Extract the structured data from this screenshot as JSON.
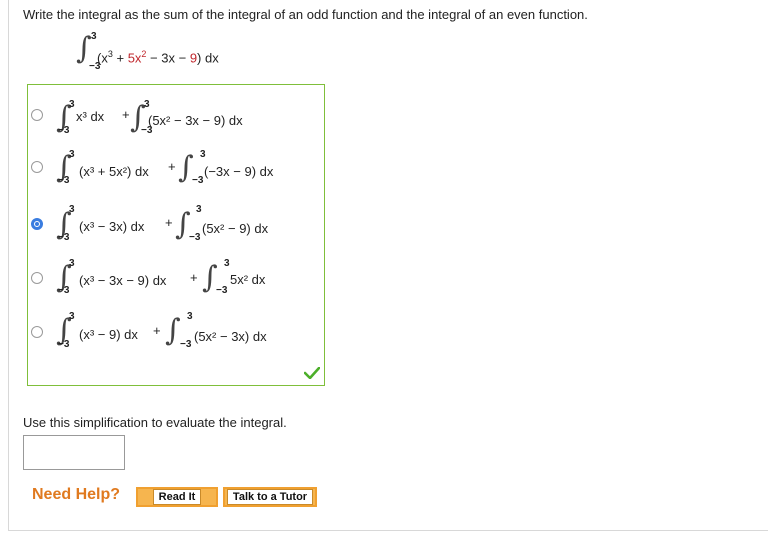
{
  "question": {
    "text": "Write the integral as the sum of the integral of an odd function and the integral of an even function."
  },
  "main_integral": {
    "upper": "3",
    "lower": "−3",
    "parts": [
      "(x",
      "3",
      " + ",
      "5x",
      "2",
      " − 3x − ",
      "9",
      ") dx"
    ]
  },
  "choices": [
    {
      "checked": false,
      "i1": {
        "upper": "3",
        "lower": "−3",
        "expr": "x³ dx"
      },
      "plus": "+",
      "i2": {
        "upper": "3",
        "lower": "−3",
        "expr": "(5x² − 3x − 9) dx"
      }
    },
    {
      "checked": false,
      "i1": {
        "upper": "3",
        "lower": "−3",
        "expr": "(x³ + 5x²) dx"
      },
      "plus": "+",
      "i2": {
        "upper": "3",
        "lower": "−3",
        "expr": "(−3x − 9) dx"
      }
    },
    {
      "checked": true,
      "i1": {
        "upper": "3",
        "lower": "−3",
        "expr": "(x³ − 3x) dx"
      },
      "plus": "+",
      "i2": {
        "upper": "3",
        "lower": "−3",
        "expr": "(5x² − 9) dx"
      }
    },
    {
      "checked": false,
      "i1": {
        "upper": "3",
        "lower": "−3",
        "expr": "(x³ − 3x − 9) dx"
      },
      "plus": "+",
      "i2": {
        "upper": "3",
        "lower": "−3",
        "expr": "5x² dx"
      }
    },
    {
      "checked": false,
      "i1": {
        "upper": "3",
        "lower": "−3",
        "expr": "(x³ − 9) dx"
      },
      "plus": "+",
      "i2": {
        "upper": "3",
        "lower": "−3",
        "expr": "(5x² − 3x) dx"
      }
    }
  ],
  "correct_icon": "checkmark-icon",
  "prompt2": "Use this simplification to evaluate the integral.",
  "answer": {
    "value": ""
  },
  "help": {
    "label": "Need Help?",
    "read_it": "Read It",
    "talk_tutor": "Talk to a Tutor"
  },
  "colors": {
    "accent": "#3a7de0",
    "correct": "#7fbf3a",
    "help": "#e07a1f",
    "button": "#f6b54f",
    "red_term": "#c0272d"
  }
}
